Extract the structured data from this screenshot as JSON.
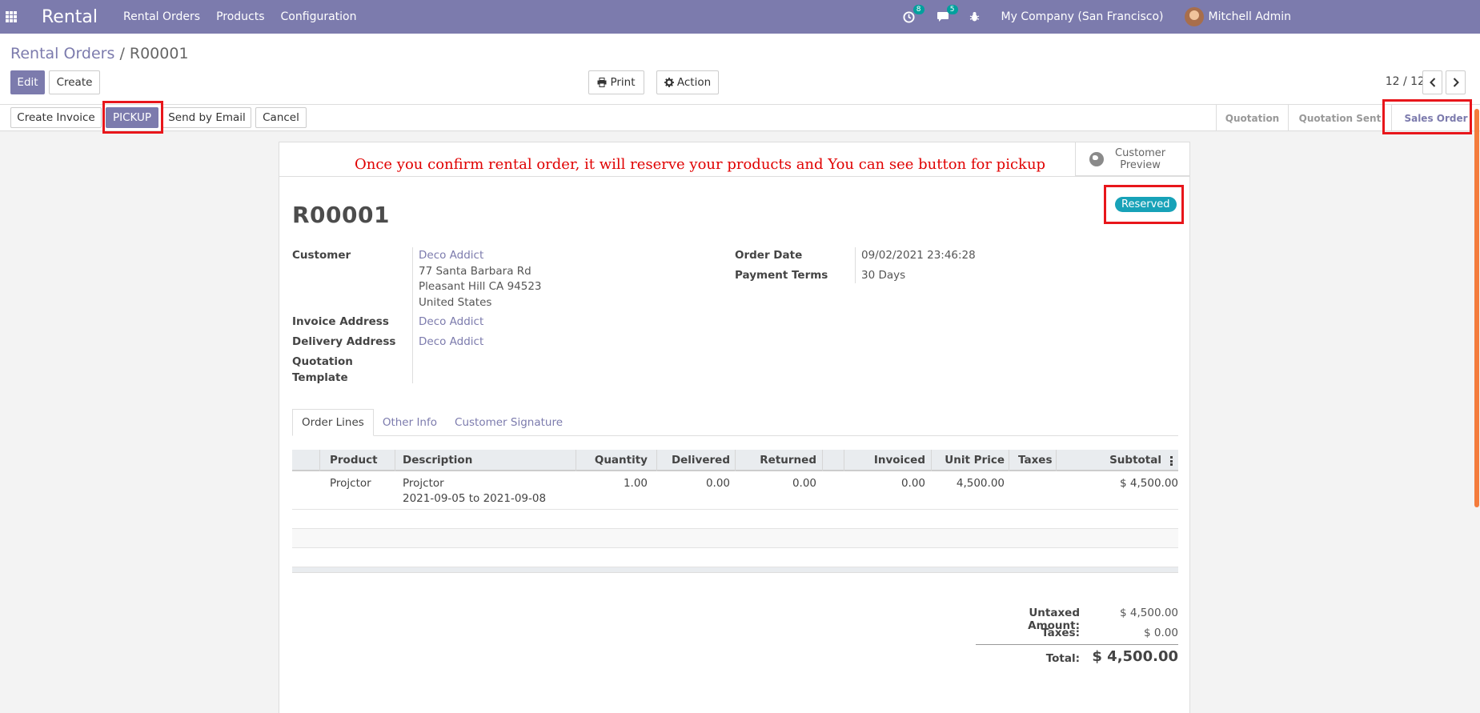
{
  "navbar": {
    "brand": "Rental",
    "menu": [
      "Rental Orders",
      "Products",
      "Configuration"
    ],
    "activity_count": "8",
    "message_count": "5",
    "company": "My Company (San Francisco)",
    "user": "Mitchell Admin"
  },
  "breadcrumb": {
    "parent": "Rental Orders",
    "separator": "/",
    "current": "R00001"
  },
  "buttons": {
    "edit": "Edit",
    "create": "Create",
    "print": "Print",
    "action": "Action"
  },
  "pager": "12 / 12",
  "header_actions": {
    "create_invoice": "Create Invoice",
    "pickup": "PICKUP",
    "send_email": "Send by Email",
    "cancel": "Cancel"
  },
  "states": [
    "Quotation",
    "Quotation Sent",
    "Sales Order"
  ],
  "active_state": "Sales Order",
  "notice": "Once you confirm rental order, it will reserve your products and You can see button for pickup",
  "customer_preview": [
    "Customer",
    "Preview"
  ],
  "order": {
    "reference": "R00001",
    "status": "Reserved"
  },
  "fields": {
    "customer_label": "Customer",
    "customer_name": "Deco Addict",
    "customer_address": [
      "77 Santa Barbara Rd",
      "Pleasant Hill CA 94523",
      "United States"
    ],
    "invoice_address_label": "Invoice Address",
    "invoice_address": "Deco Addict",
    "delivery_address_label": "Delivery Address",
    "delivery_address": "Deco Addict",
    "quotation_template_label": [
      "Quotation",
      "Template"
    ],
    "order_date_label": "Order Date",
    "order_date": "09/02/2021 23:46:28",
    "payment_terms_label": "Payment Terms",
    "payment_terms": "30 Days"
  },
  "tabs": [
    "Order Lines",
    "Other Info",
    "Customer Signature"
  ],
  "table": {
    "headers": [
      "Product",
      "Description",
      "Quantity",
      "Delivered",
      "Returned",
      "Invoiced",
      "Unit Price",
      "Taxes",
      "Subtotal"
    ],
    "rows": [
      {
        "product": "Projctor",
        "description": [
          "Projctor",
          "2021-09-05 to 2021-09-08"
        ],
        "quantity": "1.00",
        "delivered": "0.00",
        "returned": "0.00",
        "invoiced": "0.00",
        "unit_price": "4,500.00",
        "taxes": "",
        "subtotal": "$ 4,500.00"
      }
    ]
  },
  "totals": {
    "untaxed_label": "Untaxed Amount:",
    "untaxed_value": "$ 4,500.00",
    "taxes_label": "Taxes:",
    "taxes_value": "$ 0.00",
    "total_label": "Total:",
    "total_value": "$ 4,500.00"
  }
}
